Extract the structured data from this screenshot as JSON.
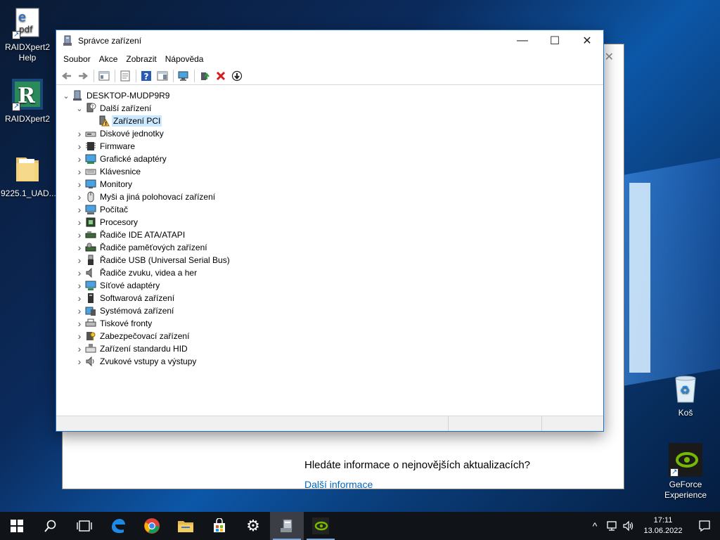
{
  "desktop": {
    "icons": [
      {
        "label": "RAIDXpert2 Help"
      },
      {
        "label": "RAIDXpert2"
      },
      {
        "label": "9225.1_UAD..."
      },
      {
        "label": "Koš"
      },
      {
        "label": "GeForce Experience"
      }
    ]
  },
  "background_window": {
    "question": "Hledáte informace o nejnovějších aktualizacích?",
    "link": "Další informace"
  },
  "window": {
    "title": "Správce zařízení",
    "controls": {
      "minimize": "—",
      "maximize": "☐",
      "close": "✕"
    },
    "menu": [
      "Soubor",
      "Akce",
      "Zobrazit",
      "Nápověda"
    ],
    "root": "DESKTOP-MUDP9R9",
    "tree": [
      {
        "label": "Další zařízení",
        "expanded": true,
        "icon": "unknown-device-icon"
      },
      {
        "label": "Zařízení PCI",
        "child": true,
        "selected": true,
        "icon": "warning-device-icon"
      },
      {
        "label": "Diskové jednotky",
        "icon": "disk-drive-icon"
      },
      {
        "label": "Firmware",
        "icon": "firmware-icon"
      },
      {
        "label": "Grafické adaptéry",
        "icon": "display-adapter-icon"
      },
      {
        "label": "Klávesnice",
        "icon": "keyboard-icon"
      },
      {
        "label": "Monitory",
        "icon": "monitor-icon"
      },
      {
        "label": "Myši a jiná polohovací zařízení",
        "icon": "mouse-icon"
      },
      {
        "label": "Počítač",
        "icon": "computer-icon"
      },
      {
        "label": "Procesory",
        "icon": "processor-icon"
      },
      {
        "label": "Řadiče IDE ATA/ATAPI",
        "icon": "ide-controller-icon"
      },
      {
        "label": "Řadiče paměťových zařízení",
        "icon": "storage-controller-icon"
      },
      {
        "label": "Řadiče USB (Universal Serial Bus)",
        "icon": "usb-icon"
      },
      {
        "label": "Řadiče zvuku, videa a her",
        "icon": "sound-icon"
      },
      {
        "label": "Síťové adaptéry",
        "icon": "network-adapter-icon"
      },
      {
        "label": "Softwarová zařízení",
        "icon": "software-device-icon"
      },
      {
        "label": "Systémová zařízení",
        "icon": "system-device-icon"
      },
      {
        "label": "Tiskové fronty",
        "icon": "printer-icon"
      },
      {
        "label": "Zabezpečovací zařízení",
        "icon": "security-device-icon"
      },
      {
        "label": "Zařízení standardu HID",
        "icon": "hid-icon"
      },
      {
        "label": "Zvukové vstupy a výstupy",
        "icon": "audio-io-icon"
      }
    ]
  },
  "taskbar": {
    "time": "17:11",
    "date": "13.06.2022"
  },
  "colors": {
    "accent": "#1e6ecc",
    "selection": "#cce8ff",
    "link": "#0067c0",
    "taskbar": "#101418"
  }
}
